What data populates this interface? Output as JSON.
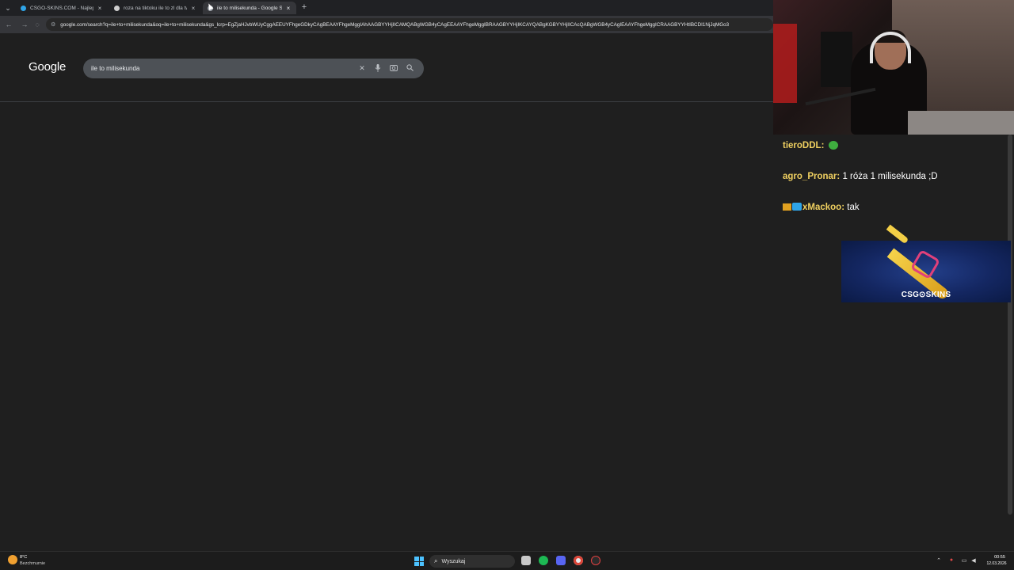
{
  "browser": {
    "tabs": [
      {
        "title": "CSGO-SKINS.COM - Najlepsze",
        "favicon_color": "#2fa4e7",
        "active": false
      },
      {
        "title": "roza na tiktoku ile to zl dla twor",
        "favicon_color": "#cfcfcf",
        "active": false
      },
      {
        "title": "ile to milisekunda - Google Sea",
        "favicon_color": "#9aa0a6",
        "active": true
      }
    ],
    "tab_close_glyph": "×",
    "new_tab_glyph": "+",
    "url": "google.com/search?q=ile+to+milisekunda&oq=ile+to+milisekunda&gs_lcrp=EgZjaHJvbWUyCggAEEUYFhgeGDkyCAgBEAAYFhgeMggIAhAAGBYYHjIICAMQABgWGB4yCAgEEAAYFhgeMggIBRAAGBYYHjIKCAYQABgKGBYYHjIICAcQABgWGB4yCAgIEAAYFhgeMggICRAAGBYYHtIBCDI1NjJqMGo3"
  },
  "google": {
    "logo": "Google",
    "query": "ile to milisekunda",
    "clear_glyph": "✕",
    "mic_glyph": "🎙",
    "lens_glyph": "◎",
    "search_glyph": "⌕"
  },
  "chat": {
    "messages": [
      {
        "user": "tieroDDL",
        "text": ""
      },
      {
        "user": "agro_Pronar",
        "text": "1 róża 1 milisekunda ;D"
      },
      {
        "user": "xMackoo",
        "text": "tak"
      }
    ]
  },
  "sponsor": {
    "text": "CSG⊙SKINS"
  },
  "taskbar": {
    "weather_temp": "8°C",
    "weather_desc": "Bezchmurnie",
    "search_placeholder": "Wyszukaj",
    "time": "00:55",
    "date": "12.03.2026"
  },
  "colors": {
    "page_bg": "#1f1f1f",
    "chat_username": "#f0d060",
    "start_blue": "#4cc2ff",
    "sponsor_bg": "#142762"
  }
}
